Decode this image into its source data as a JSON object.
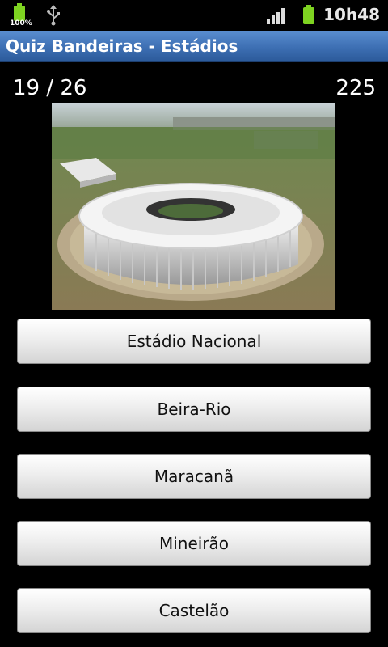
{
  "status_bar": {
    "battery_left_percent": "100%",
    "time": "10h48",
    "icons": [
      "battery-icon",
      "usb-icon",
      "signal-icon",
      "battery-icon"
    ]
  },
  "header": {
    "title": "Quiz Bandeiras - Estádios"
  },
  "quiz": {
    "progress": "19 / 26",
    "score": "225",
    "image": "stadium-photo"
  },
  "answers": [
    {
      "label": "Estádio Nacional"
    },
    {
      "label": "Beira-Rio"
    },
    {
      "label": "Maracanã"
    },
    {
      "label": "Mineirão"
    },
    {
      "label": "Castelão"
    }
  ],
  "colors": {
    "background": "#000000",
    "title_bar": "#3d6fb3",
    "battery_green": "#7ed321"
  }
}
